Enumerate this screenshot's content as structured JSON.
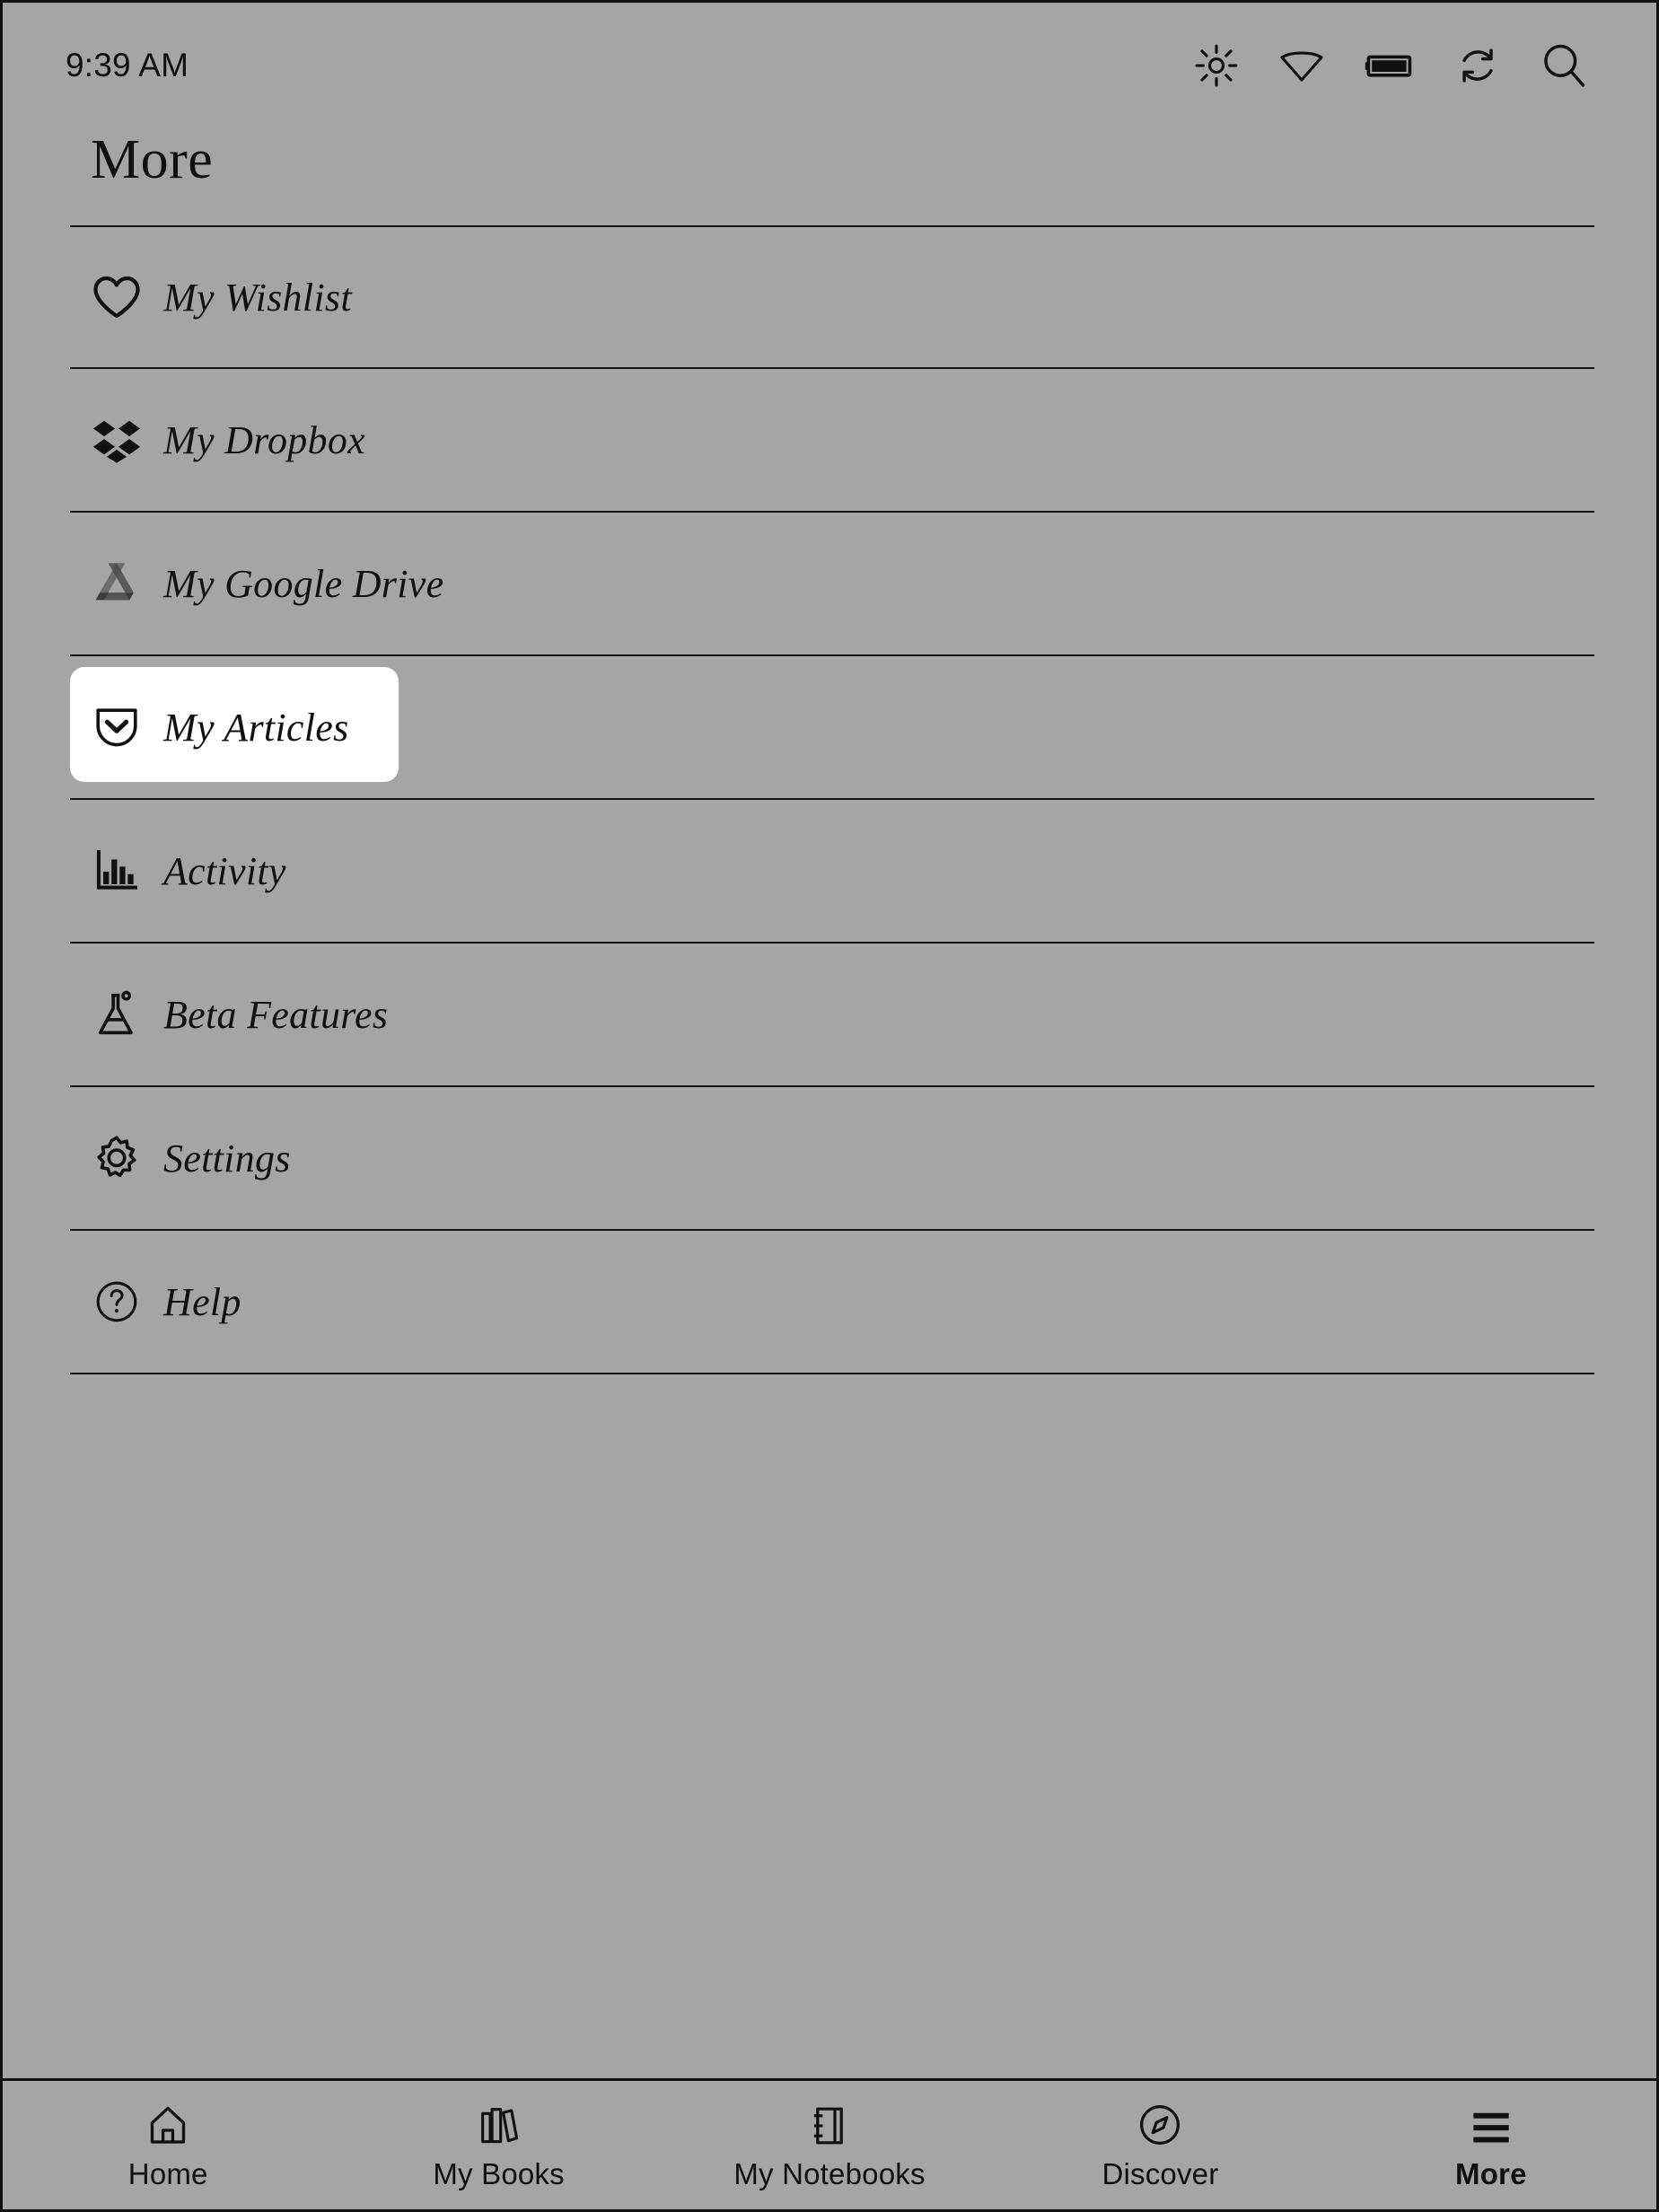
{
  "status": {
    "time": "9:39 AM",
    "icons": [
      {
        "name": "brightness-icon",
        "label": "Brightness"
      },
      {
        "name": "wifi-icon",
        "label": "Wi-Fi"
      },
      {
        "name": "battery-icon",
        "label": "Battery full"
      },
      {
        "name": "sync-icon",
        "label": "Sync"
      },
      {
        "name": "search-icon",
        "label": "Search"
      }
    ]
  },
  "header": {
    "title": "More"
  },
  "menu": {
    "items": [
      {
        "label": "My Wishlist",
        "icon": "heart-icon",
        "selected": false
      },
      {
        "label": "My Dropbox",
        "icon": "dropbox-icon",
        "selected": false
      },
      {
        "label": "My Google Drive",
        "icon": "google-drive-icon",
        "selected": false
      },
      {
        "label": "My Articles",
        "icon": "pocket-icon",
        "selected": true
      },
      {
        "label": "Activity",
        "icon": "bar-chart-icon",
        "selected": false
      },
      {
        "label": "Beta Features",
        "icon": "flask-icon",
        "selected": false
      },
      {
        "label": "Settings",
        "icon": "gear-icon",
        "selected": false
      },
      {
        "label": "Help",
        "icon": "question-circle-icon",
        "selected": false
      }
    ]
  },
  "bottom_nav": {
    "items": [
      {
        "label": "Home",
        "icon": "home-icon",
        "active": false
      },
      {
        "label": "My Books",
        "icon": "books-icon",
        "active": false
      },
      {
        "label": "My Notebooks",
        "icon": "notebook-icon",
        "active": false
      },
      {
        "label": "Discover",
        "icon": "compass-icon",
        "active": false
      },
      {
        "label": "More",
        "icon": "hamburger-icon",
        "active": true
      }
    ]
  },
  "colors": {
    "background": "#a5a5a5",
    "foreground": "#121212",
    "highlight": "#ffffff"
  }
}
